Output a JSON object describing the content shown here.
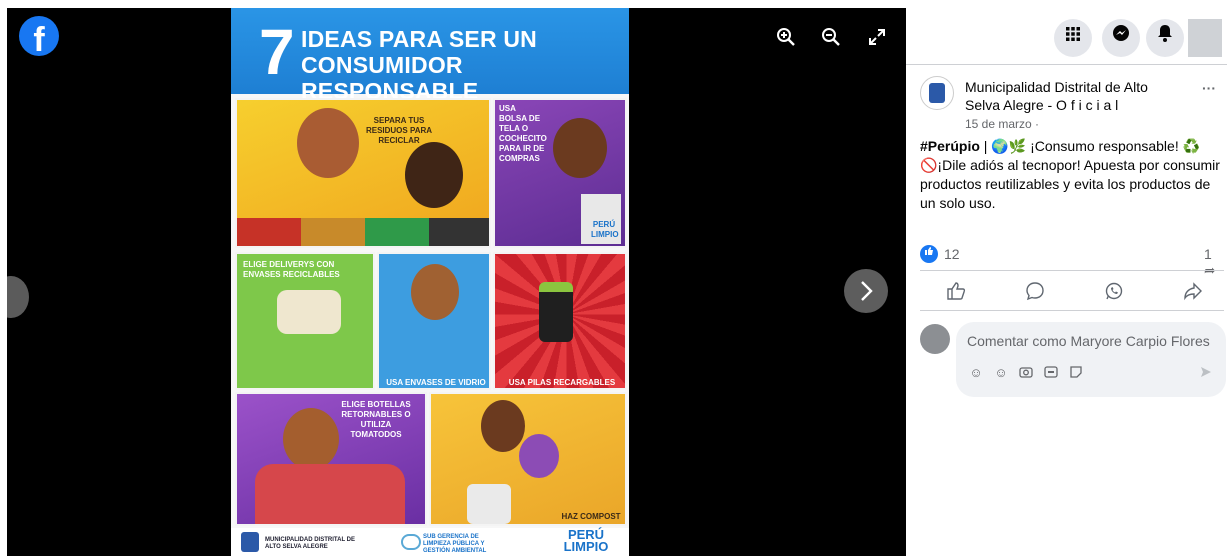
{
  "viewer": {
    "tools": {
      "zoom_in": "zoom-in-icon",
      "zoom_out": "zoom-out-icon",
      "fullscreen": "fullscreen-icon"
    },
    "poster": {
      "number": "7",
      "title_line1": "IDEAS PARA SER UN",
      "title_line2": "CONSUMIDOR RESPONSABLE",
      "panels": {
        "separa": "SEPARA TUS RESIDUOS PARA RECICLAR",
        "bolsa": "USA BOLSA DE TELA O COCHECITO PARA IR DE COMPRAS",
        "bolsa_tag": "PERÚ LIMPIO",
        "deliverys": "ELIGE DELIVERYS CON ENVASES RECICLABLES",
        "vidrio": "USA ENVASES DE VIDRIO",
        "pilas": "USA PILAS RECARGABLES",
        "botellas": "ELIGE BOTELLAS RETORNABLES O UTILIZA TOMATODOS",
        "compost": "HAZ COMPOST"
      },
      "footer": {
        "muni": "MUNICIPALIDAD DISTRITAL DE ALTO SELVA ALEGRE",
        "sub": "SUB GERENCIA DE LIMPIEZA PÚBLICA Y GESTIÓN AMBIENTAL",
        "peru": "PERÚ LIMPIO"
      }
    }
  },
  "topbar": {
    "icons": [
      "menu-grid-icon",
      "messenger-icon",
      "notifications-icon"
    ]
  },
  "post": {
    "author": "Municipalidad Distrital de Alto Selva Alegre - O f i c i a l",
    "date": "15 de marzo ·",
    "more": "···",
    "hashtag": "#Perúpio",
    "text_part1": " | 🌍🌿 ¡Consumo responsable! ♻️",
    "text_part2": "🚫¡Dile adiós al tecnopor! Apuesta por consumir productos reutilizables y evita los productos de un solo uso.",
    "reactions": "12",
    "shares": "1"
  },
  "comment": {
    "placeholder": "Comentar como Maryore Carpio Flores"
  },
  "colors": {
    "facebook_blue": "#1877f2",
    "poster_header": "#2a95e6"
  }
}
